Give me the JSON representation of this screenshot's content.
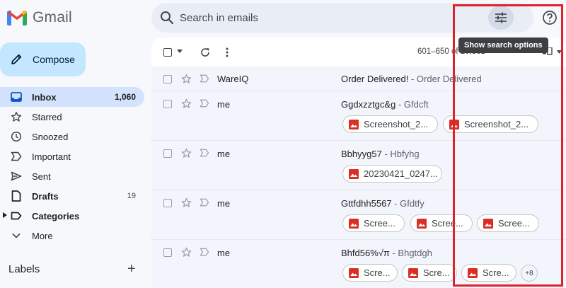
{
  "app": {
    "name": "Gmail"
  },
  "search": {
    "placeholder": "Search in emails",
    "tooltip": "Show search options"
  },
  "compose": {
    "label": "Compose"
  },
  "nav": [
    {
      "label": "Inbox",
      "count": "1,060",
      "icon": "inbox-icon",
      "active": true
    },
    {
      "label": "Starred",
      "count": "",
      "icon": "star-icon"
    },
    {
      "label": "Snoozed",
      "count": "",
      "icon": "clock-icon"
    },
    {
      "label": "Important",
      "count": "",
      "icon": "important-icon"
    },
    {
      "label": "Sent",
      "count": "",
      "icon": "send-icon"
    },
    {
      "label": "Drafts",
      "count": "19",
      "icon": "draft-icon"
    },
    {
      "label": "Categories",
      "count": "",
      "icon": "label-icon"
    },
    {
      "label": "More",
      "count": "",
      "icon": "chevron-down-icon"
    }
  ],
  "labels": {
    "heading": "Labels",
    "add": "+"
  },
  "toolbar": {
    "pagination": "601–650 of 10,361"
  },
  "emails": [
    {
      "sender": "WareIQ",
      "subject": "Order Delivered!",
      "snippet": " - Order Delivered",
      "attachments": []
    },
    {
      "sender": "me",
      "subject": "Ggdxzztgc&g",
      "snippet": " - Gfdcft",
      "attachments": [
        "Screenshot_2...",
        "Screenshot_2..."
      ]
    },
    {
      "sender": "me",
      "subject": "Bbhyyg57",
      "snippet": " - Hbfyhg",
      "attachments": [
        "20230421_0247..."
      ]
    },
    {
      "sender": "me",
      "subject": "Gttfdhh5567",
      "snippet": " - Gfdtfy",
      "attachments": [
        "Scree...",
        "Scree...",
        "Scree..."
      ]
    },
    {
      "sender": "me",
      "subject": "Bhfd56%√π",
      "snippet": " - Bhgtdgh",
      "attachments": [
        "Scre...",
        "Scre...",
        "Scre..."
      ],
      "more_attachments": "+8"
    }
  ],
  "colors": {
    "accent": "#c2e7ff",
    "active_nav": "#d3e3fd",
    "highlight": "#e0202a",
    "image_icon": "#d93025"
  }
}
